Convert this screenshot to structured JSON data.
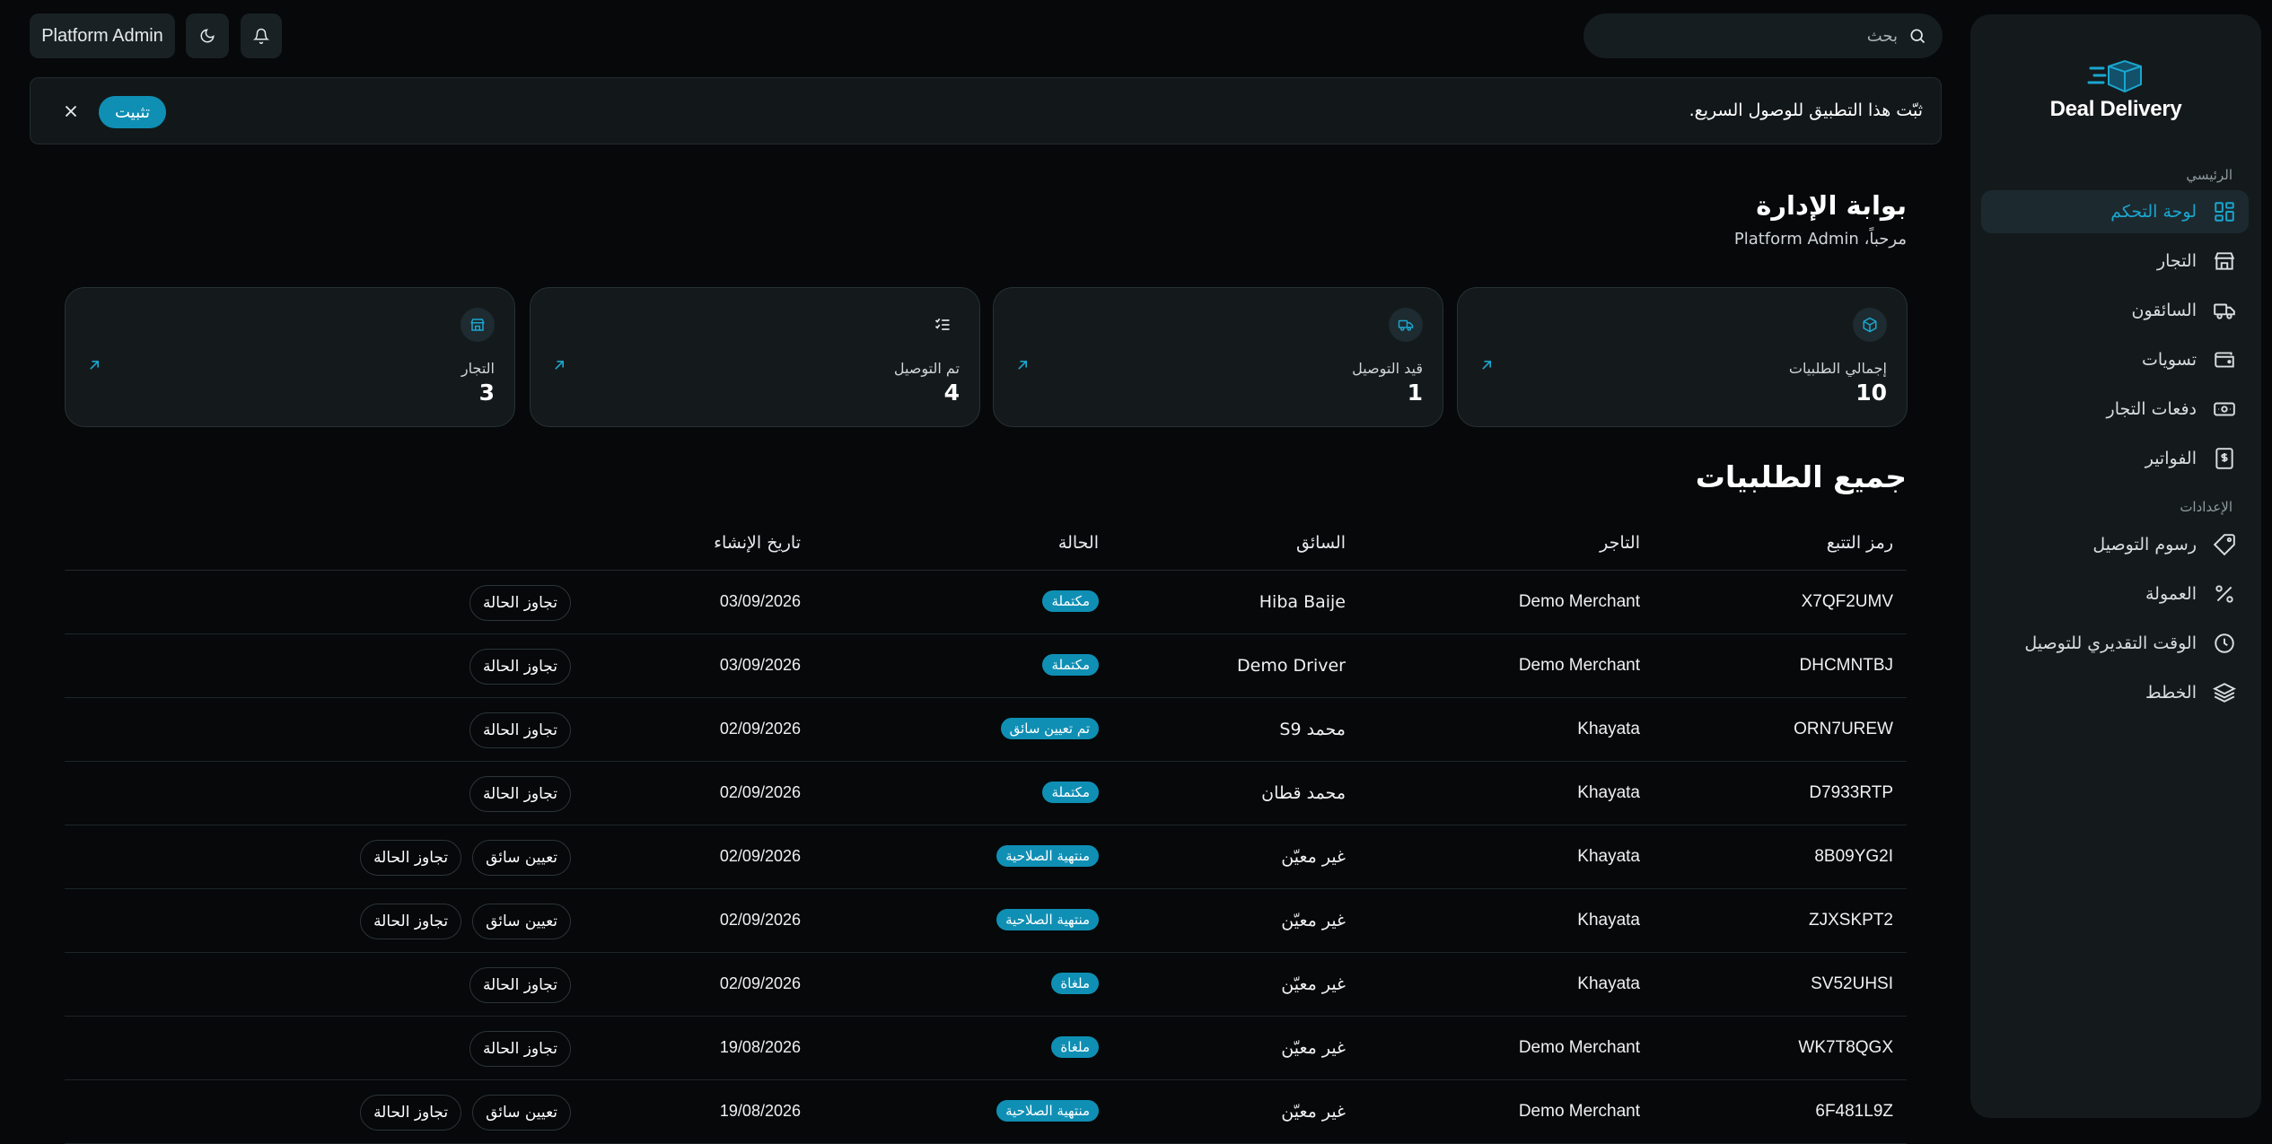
{
  "brand": {
    "name": "Deal Delivery"
  },
  "sidebar": {
    "main_section": "الرئيسي",
    "settings_section": "الإعدادات",
    "items": [
      {
        "label": "لوحة التحكم",
        "icon": "dashboard-icon",
        "active": true
      },
      {
        "label": "التجار",
        "icon": "store-icon"
      },
      {
        "label": "السائقون",
        "icon": "truck-icon"
      },
      {
        "label": "تسويات",
        "icon": "wallet-icon"
      },
      {
        "label": "دفعات التجار",
        "icon": "banknote-icon"
      },
      {
        "label": "الفواتير",
        "icon": "receipt-icon"
      }
    ],
    "settings_items": [
      {
        "label": "رسوم التوصيل",
        "icon": "tag-icon"
      },
      {
        "label": "العمولة",
        "icon": "percent-icon"
      },
      {
        "label": "الوقت التقديري للتوصيل",
        "icon": "clock-icon"
      },
      {
        "label": "الخطط",
        "icon": "layers-icon"
      }
    ]
  },
  "topbar": {
    "search_placeholder": "بحث",
    "user_label": "Platform Admin"
  },
  "banner": {
    "message": "ثبّت هذا التطبيق للوصول السريع.",
    "install_label": "تثبيت"
  },
  "header": {
    "title": "بوابة الإدارة",
    "welcome": "مرحباً، Platform Admin"
  },
  "stats": [
    {
      "label": "إجمالي الطلبيات",
      "value": "10",
      "icon": "package-icon"
    },
    {
      "label": "قيد التوصيل",
      "value": "1",
      "icon": "truck-icon"
    },
    {
      "label": "تم التوصيل",
      "value": "4",
      "icon": "checklist-icon"
    },
    {
      "label": "التجار",
      "value": "3",
      "icon": "store-icon"
    }
  ],
  "orders": {
    "title": "جميع الطلبيات",
    "columns": [
      "رمز التتبع",
      "التاجر",
      "السائق",
      "الحالة",
      "تاريخ الإنشاء"
    ],
    "rows": [
      {
        "tracking": "X7QF2UMV",
        "merchant": "Demo Merchant",
        "driver": "Hiba Baije",
        "status": "مكتملة",
        "date": "03/09/2026",
        "actions": [
          "تجاوز الحالة"
        ]
      },
      {
        "tracking": "DHCMNTBJ",
        "merchant": "Demo Merchant",
        "driver": "Demo Driver",
        "status": "مكتملة",
        "date": "03/09/2026",
        "actions": [
          "تجاوز الحالة"
        ]
      },
      {
        "tracking": "ORN7UREW",
        "merchant": "Khayata",
        "driver": "محمد S9",
        "status": "تم تعيين سائق",
        "date": "02/09/2026",
        "actions": [
          "تجاوز الحالة"
        ]
      },
      {
        "tracking": "D7933RTP",
        "merchant": "Khayata",
        "driver": "محمد قطان",
        "status": "مكتملة",
        "date": "02/09/2026",
        "actions": [
          "تجاوز الحالة"
        ]
      },
      {
        "tracking": "8B09YG2I",
        "merchant": "Khayata",
        "driver": "غير معيّن",
        "status": "منتهية الصلاحية",
        "date": "02/09/2026",
        "actions": [
          "تعيين سائق",
          "تجاوز الحالة"
        ]
      },
      {
        "tracking": "ZJXSKPT2",
        "merchant": "Khayata",
        "driver": "غير معيّن",
        "status": "منتهية الصلاحية",
        "date": "02/09/2026",
        "actions": [
          "تعيين سائق",
          "تجاوز الحالة"
        ]
      },
      {
        "tracking": "SV52UHSI",
        "merchant": "Khayata",
        "driver": "غير معيّن",
        "status": "ملغاة",
        "date": "02/09/2026",
        "actions": [
          "تجاوز الحالة"
        ]
      },
      {
        "tracking": "WK7T8QGX",
        "merchant": "Demo Merchant",
        "driver": "غير معيّن",
        "status": "ملغاة",
        "date": "19/08/2026",
        "actions": [
          "تجاوز الحالة"
        ]
      },
      {
        "tracking": "6F481L9Z",
        "merchant": "Demo Merchant",
        "driver": "غير معيّن",
        "status": "منتهية الصلاحية",
        "date": "19/08/2026",
        "actions": [
          "تعيين سائق",
          "تجاوز الحالة"
        ]
      }
    ]
  },
  "colors": {
    "accent": "#0f8fb4",
    "background": "#060809",
    "panel": "#141a1c"
  }
}
